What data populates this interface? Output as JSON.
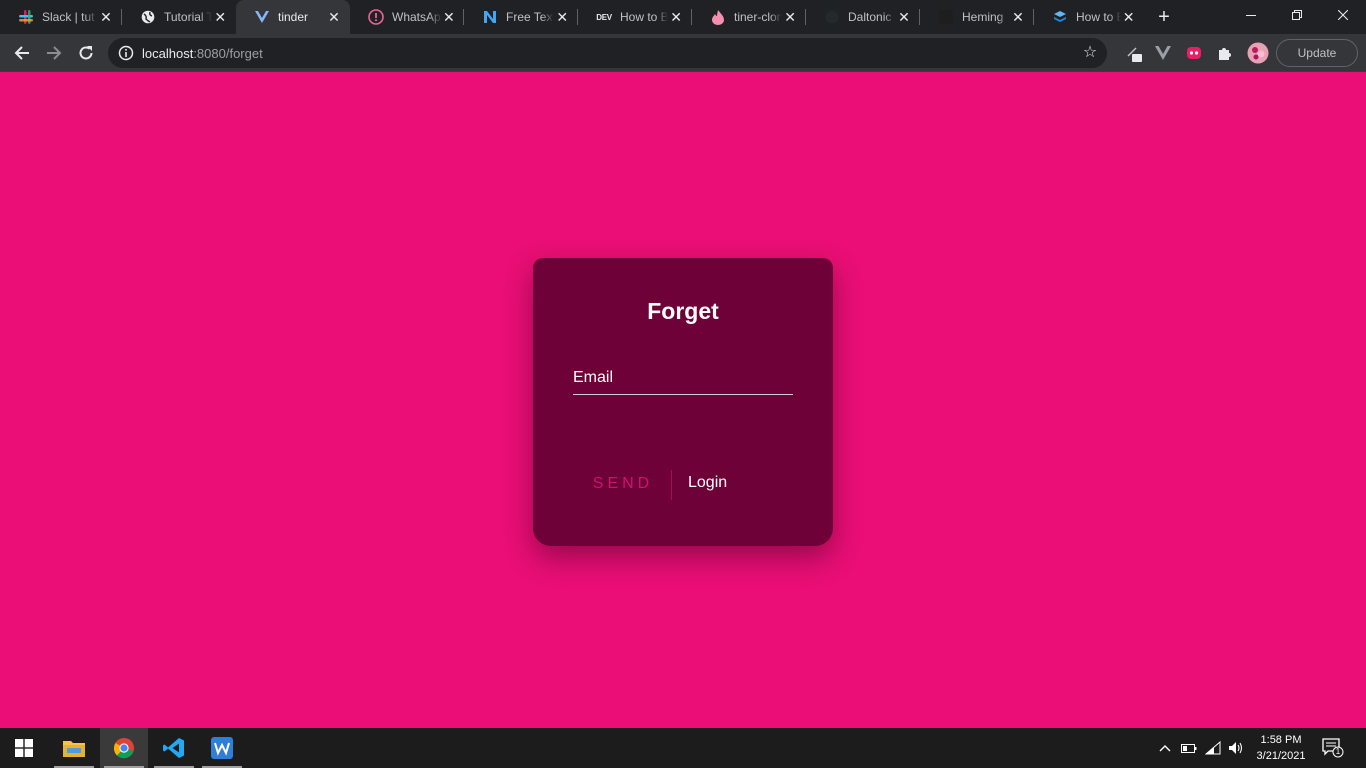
{
  "browser": {
    "tabs": [
      {
        "title": "Slack | tut",
        "icon": "slack-icon",
        "active": false
      },
      {
        "title": "Tutorial T",
        "icon": "globe-icon",
        "active": false
      },
      {
        "title": "tinder",
        "icon": "vue-icon",
        "active": true
      },
      {
        "title": "WhatsApp",
        "icon": "whatsapp-alert-icon",
        "active": false
      },
      {
        "title": "Free Text",
        "icon": "n-logo-icon",
        "active": false
      },
      {
        "title": "How to B",
        "icon": "dev-icon",
        "active": false
      },
      {
        "title": "tiner-clon",
        "icon": "firebase-icon",
        "active": false
      },
      {
        "title": "Daltonic",
        "icon": "github-icon",
        "active": false
      },
      {
        "title": "Heming",
        "icon": "hemingway-icon",
        "active": false
      },
      {
        "title": "How to B",
        "icon": "stack-icon",
        "active": false
      }
    ],
    "new_tab": "+",
    "address": {
      "host": "localhost",
      "path": ":8080/forget"
    },
    "update_label": "Update"
  },
  "page": {
    "background": "#ea0e76",
    "card_color": "#6e0238",
    "heading": "Forget",
    "email_placeholder": "Email",
    "send_label": "SEND",
    "login_label": "Login"
  },
  "taskbar": {
    "apps": [
      "start-icon",
      "file-explorer-icon",
      "chrome-icon",
      "vscode-icon",
      "wps-writer-icon"
    ],
    "time": "1:58 PM",
    "date": "3/21/2021",
    "notification_count": "1"
  }
}
